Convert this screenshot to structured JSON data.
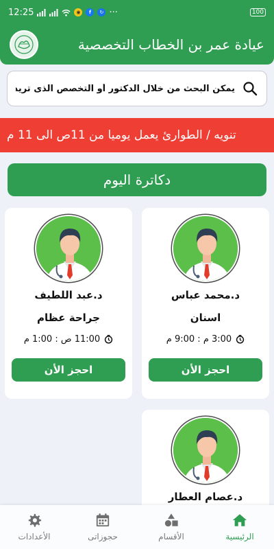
{
  "status_bar": {
    "time": "12:25",
    "battery": "100",
    "more": "···"
  },
  "app_bar": {
    "title": "عيادة عمر بن الخطاب التخصصية"
  },
  "search": {
    "placeholder": "يمكن البحث من خلال الدكتور أو التخصص الذى تريده"
  },
  "notice": {
    "text": "تنويه / الطوارئ يعمل يوميا من 11ص الى 11 م"
  },
  "section": {
    "title": "دكاترة اليوم"
  },
  "doctors": [
    {
      "name": "د.محمد عباس",
      "specialty": "اسنان",
      "time": "3:00 م : 9:00 م",
      "book_label": "احجز الأن"
    },
    {
      "name": "د.عبد اللطيف",
      "specialty": "جراحة عظام",
      "time": "11:00 ص : 1:00 م",
      "book_label": "احجز الأن"
    },
    {
      "name": "د.عصام العطار"
    }
  ],
  "bottom_nav": [
    {
      "label": "الرئيسية",
      "icon": "home-icon"
    },
    {
      "label": "الأقسام",
      "icon": "shapes-icon"
    },
    {
      "label": "حجوزاتى",
      "icon": "calendar-icon"
    },
    {
      "label": "الأعدادات",
      "icon": "gear-icon"
    }
  ],
  "colors": {
    "primary": "#2f9e52",
    "notice": "#ef3e34",
    "background": "#eef2f8",
    "avatar_bg": "#5bbf4a"
  }
}
